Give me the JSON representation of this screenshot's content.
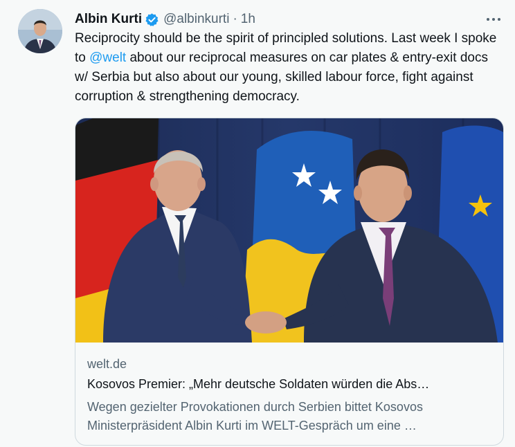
{
  "tweet": {
    "author_name": "Albin Kurti",
    "handle": "@albinkurti",
    "separator": "·",
    "time": "1h",
    "text_before_mention": "Reciprocity should be the spirit of principled solutions. Last week I spoke to ",
    "mention": "@welt",
    "text_after_mention": " about our reciprocal measures on car plates & entry-exit docs w/ Serbia but also about our young, skilled labour force, fight against corruption & strengthening democracy."
  },
  "card": {
    "domain": "welt.de",
    "title": "Kosovos Premier: „Mehr deutsche Soldaten würden die Abs…",
    "description": "Wegen gezielter Provokationen durch Serbien bittet Kosovos Ministerpräsident Albin Kurti im WELT-Gespräch um eine …"
  },
  "icons": {
    "verified": "verified-badge-icon",
    "more": "more-options-icon"
  },
  "colors": {
    "accent": "#1d9bf0",
    "text": "#0f1419",
    "secondary": "#536471",
    "background": "#f7f9f9"
  }
}
